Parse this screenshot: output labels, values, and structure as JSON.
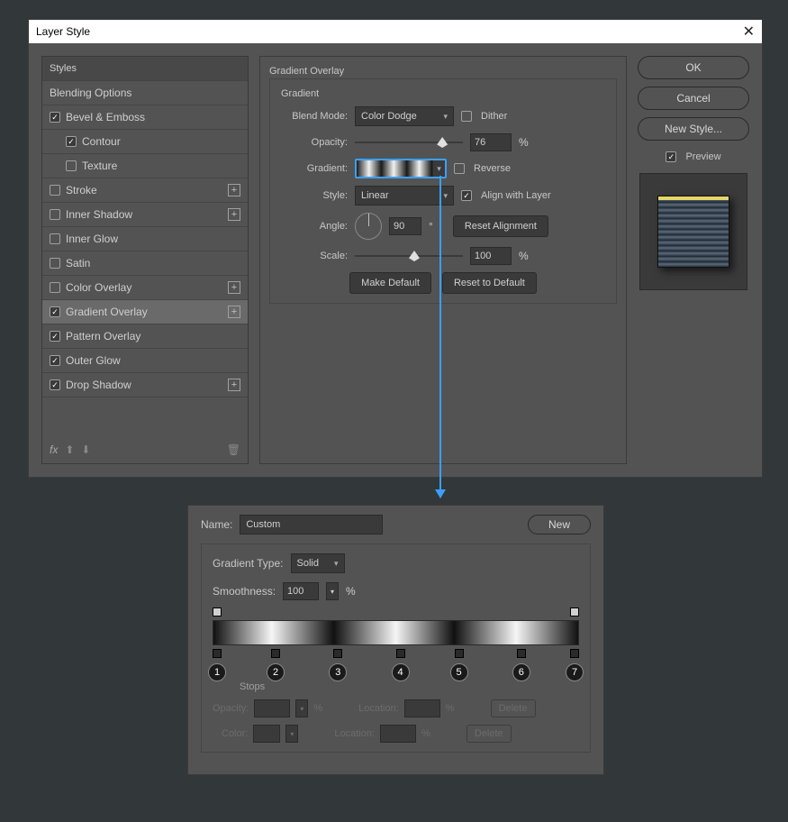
{
  "dialog": {
    "title": "Layer Style",
    "close": "✕"
  },
  "sidebar": {
    "header": "Styles",
    "items": [
      {
        "label": "Blending Options",
        "checked": null
      },
      {
        "label": "Bevel & Emboss",
        "checked": true
      },
      {
        "label": "Contour",
        "checked": true,
        "sub": true
      },
      {
        "label": "Texture",
        "checked": false,
        "sub": true
      },
      {
        "label": "Stroke",
        "checked": false,
        "plus": true
      },
      {
        "label": "Inner Shadow",
        "checked": false,
        "plus": true
      },
      {
        "label": "Inner Glow",
        "checked": false
      },
      {
        "label": "Satin",
        "checked": false
      },
      {
        "label": "Color Overlay",
        "checked": false,
        "plus": true
      },
      {
        "label": "Gradient Overlay",
        "checked": true,
        "plus": true,
        "selected": true
      },
      {
        "label": "Pattern Overlay",
        "checked": true
      },
      {
        "label": "Outer Glow",
        "checked": true
      },
      {
        "label": "Drop Shadow",
        "checked": true,
        "plus": true
      }
    ],
    "fx_label": "fx"
  },
  "gradient_overlay": {
    "group": "Gradient Overlay",
    "sub": "Gradient",
    "blend_mode_label": "Blend Mode:",
    "blend_mode_value": "Color Dodge",
    "dither_label": "Dither",
    "dither_checked": false,
    "opacity_label": "Opacity:",
    "opacity_value": "76",
    "pct": "%",
    "gradient_label": "Gradient:",
    "reverse_label": "Reverse",
    "reverse_checked": false,
    "style_label": "Style:",
    "style_value": "Linear",
    "align_label": "Align with Layer",
    "align_checked": true,
    "angle_label": "Angle:",
    "angle_value": "90",
    "deg": "°",
    "reset_align": "Reset Alignment",
    "scale_label": "Scale:",
    "scale_value": "100",
    "make_default": "Make Default",
    "reset_default": "Reset to Default"
  },
  "right": {
    "ok": "OK",
    "cancel": "Cancel",
    "new_style": "New Style...",
    "preview": "Preview",
    "preview_checked": true
  },
  "editor": {
    "name_label": "Name:",
    "name_value": "Custom",
    "new": "New",
    "type_label": "Gradient Type:",
    "type_value": "Solid",
    "smoothness_label": "Smoothness:",
    "smoothness_value": "100",
    "pct": "%",
    "stops_label": "Stops",
    "opacity_label": "Opacity:",
    "location_label": "Location:",
    "color_label": "Color:",
    "delete": "Delete",
    "stop_numbers": [
      "1",
      "2",
      "3",
      "4",
      "5",
      "6",
      "7"
    ]
  }
}
